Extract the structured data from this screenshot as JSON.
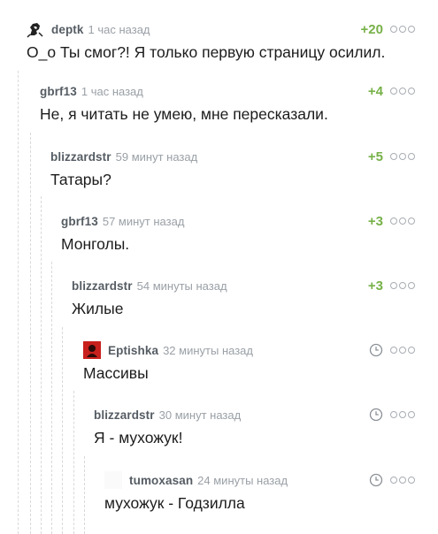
{
  "comments": [
    {
      "author": "deptk",
      "time": "1 час назад",
      "rating": "+20",
      "text": "О_о Ты смог?! Я только первую страницу осилил."
    },
    {
      "author": "gbrf13",
      "time": "1 час назад",
      "rating": "+4",
      "text": "Не, я читать не умею, мне пересказали."
    },
    {
      "author": "blizzardstr",
      "time": "59 минут назад",
      "rating": "+5",
      "text": "Татары?"
    },
    {
      "author": "gbrf13",
      "time": "57 минут назад",
      "rating": "+3",
      "text": "Монголы."
    },
    {
      "author": "blizzardstr",
      "time": "54 минуты назад",
      "rating": "+3",
      "text": "Жилые"
    },
    {
      "author": "Eptishka",
      "time": "32 минуты назад",
      "rating": null,
      "text": "Массивы"
    },
    {
      "author": "blizzardstr",
      "time": "30 минут назад",
      "rating": null,
      "text": "Я - мухожук!"
    },
    {
      "author": "tumoxasan",
      "time": "24 минуты назад",
      "rating": null,
      "text": "мухожук - Годзилла"
    }
  ],
  "colors": {
    "rating": "#77b148",
    "author": "#555c63",
    "time": "#9aa0a6",
    "guide": "#d9d9d9"
  },
  "icons": {
    "more": "more-options-icon",
    "clock": "clock-icon",
    "avatar_deptk": "sketch-portrait-avatar",
    "avatar_eptishka": "red-square-avatar"
  }
}
